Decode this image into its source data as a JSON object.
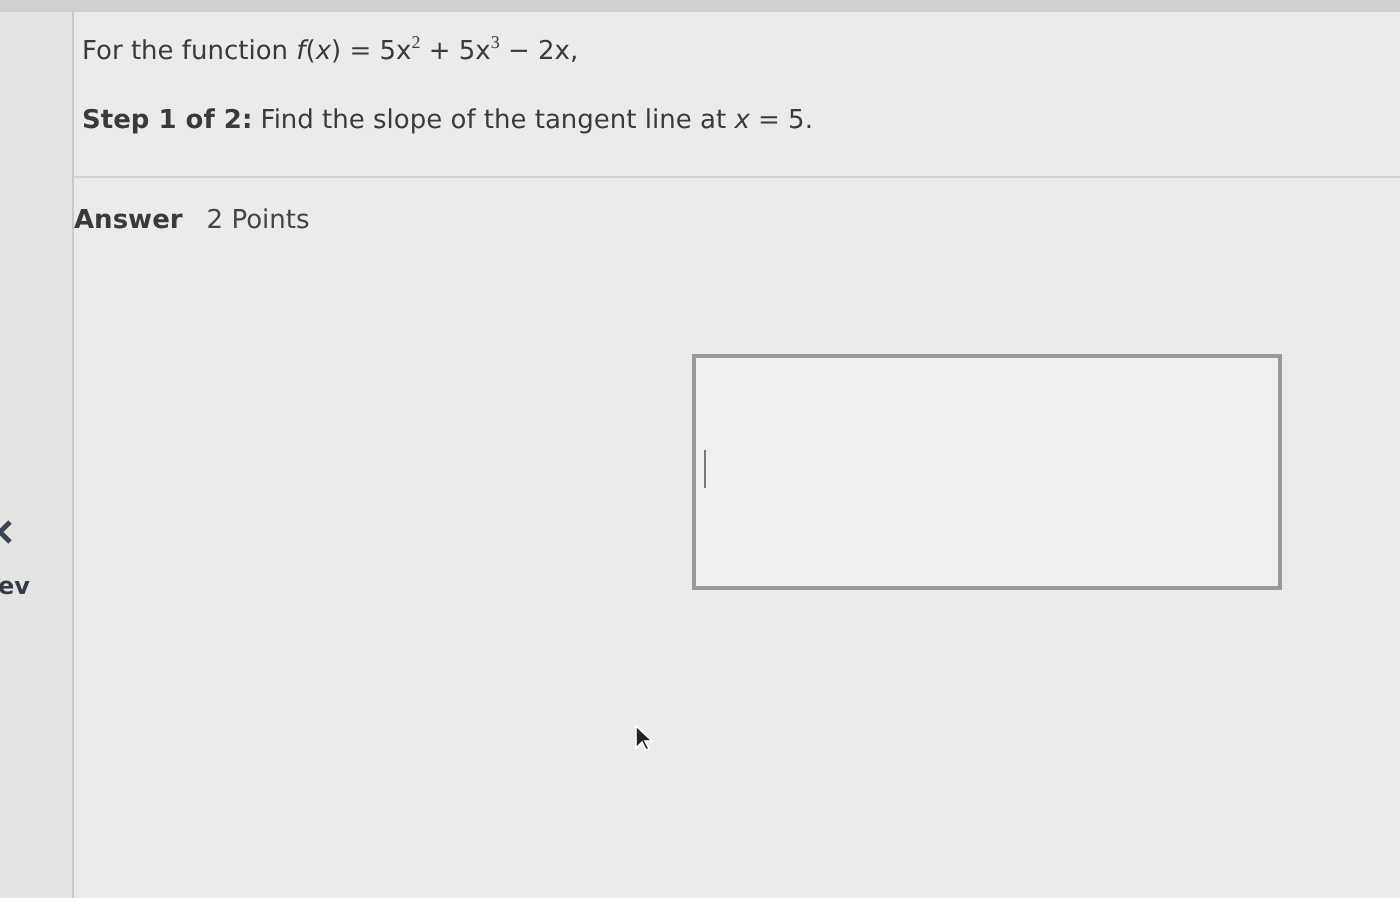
{
  "sidebar": {
    "prev_label": "ev"
  },
  "question": {
    "prompt": "For the function *f*(*x*) = 5x$^{2}$ + 5x$^{3}$ − 2x,",
    "step": "**Step 1 of 2:** Find the slope of the tangent line at *x* = 5."
  },
  "answer": {
    "label": "Answer",
    "points": "2 Points"
  }
}
